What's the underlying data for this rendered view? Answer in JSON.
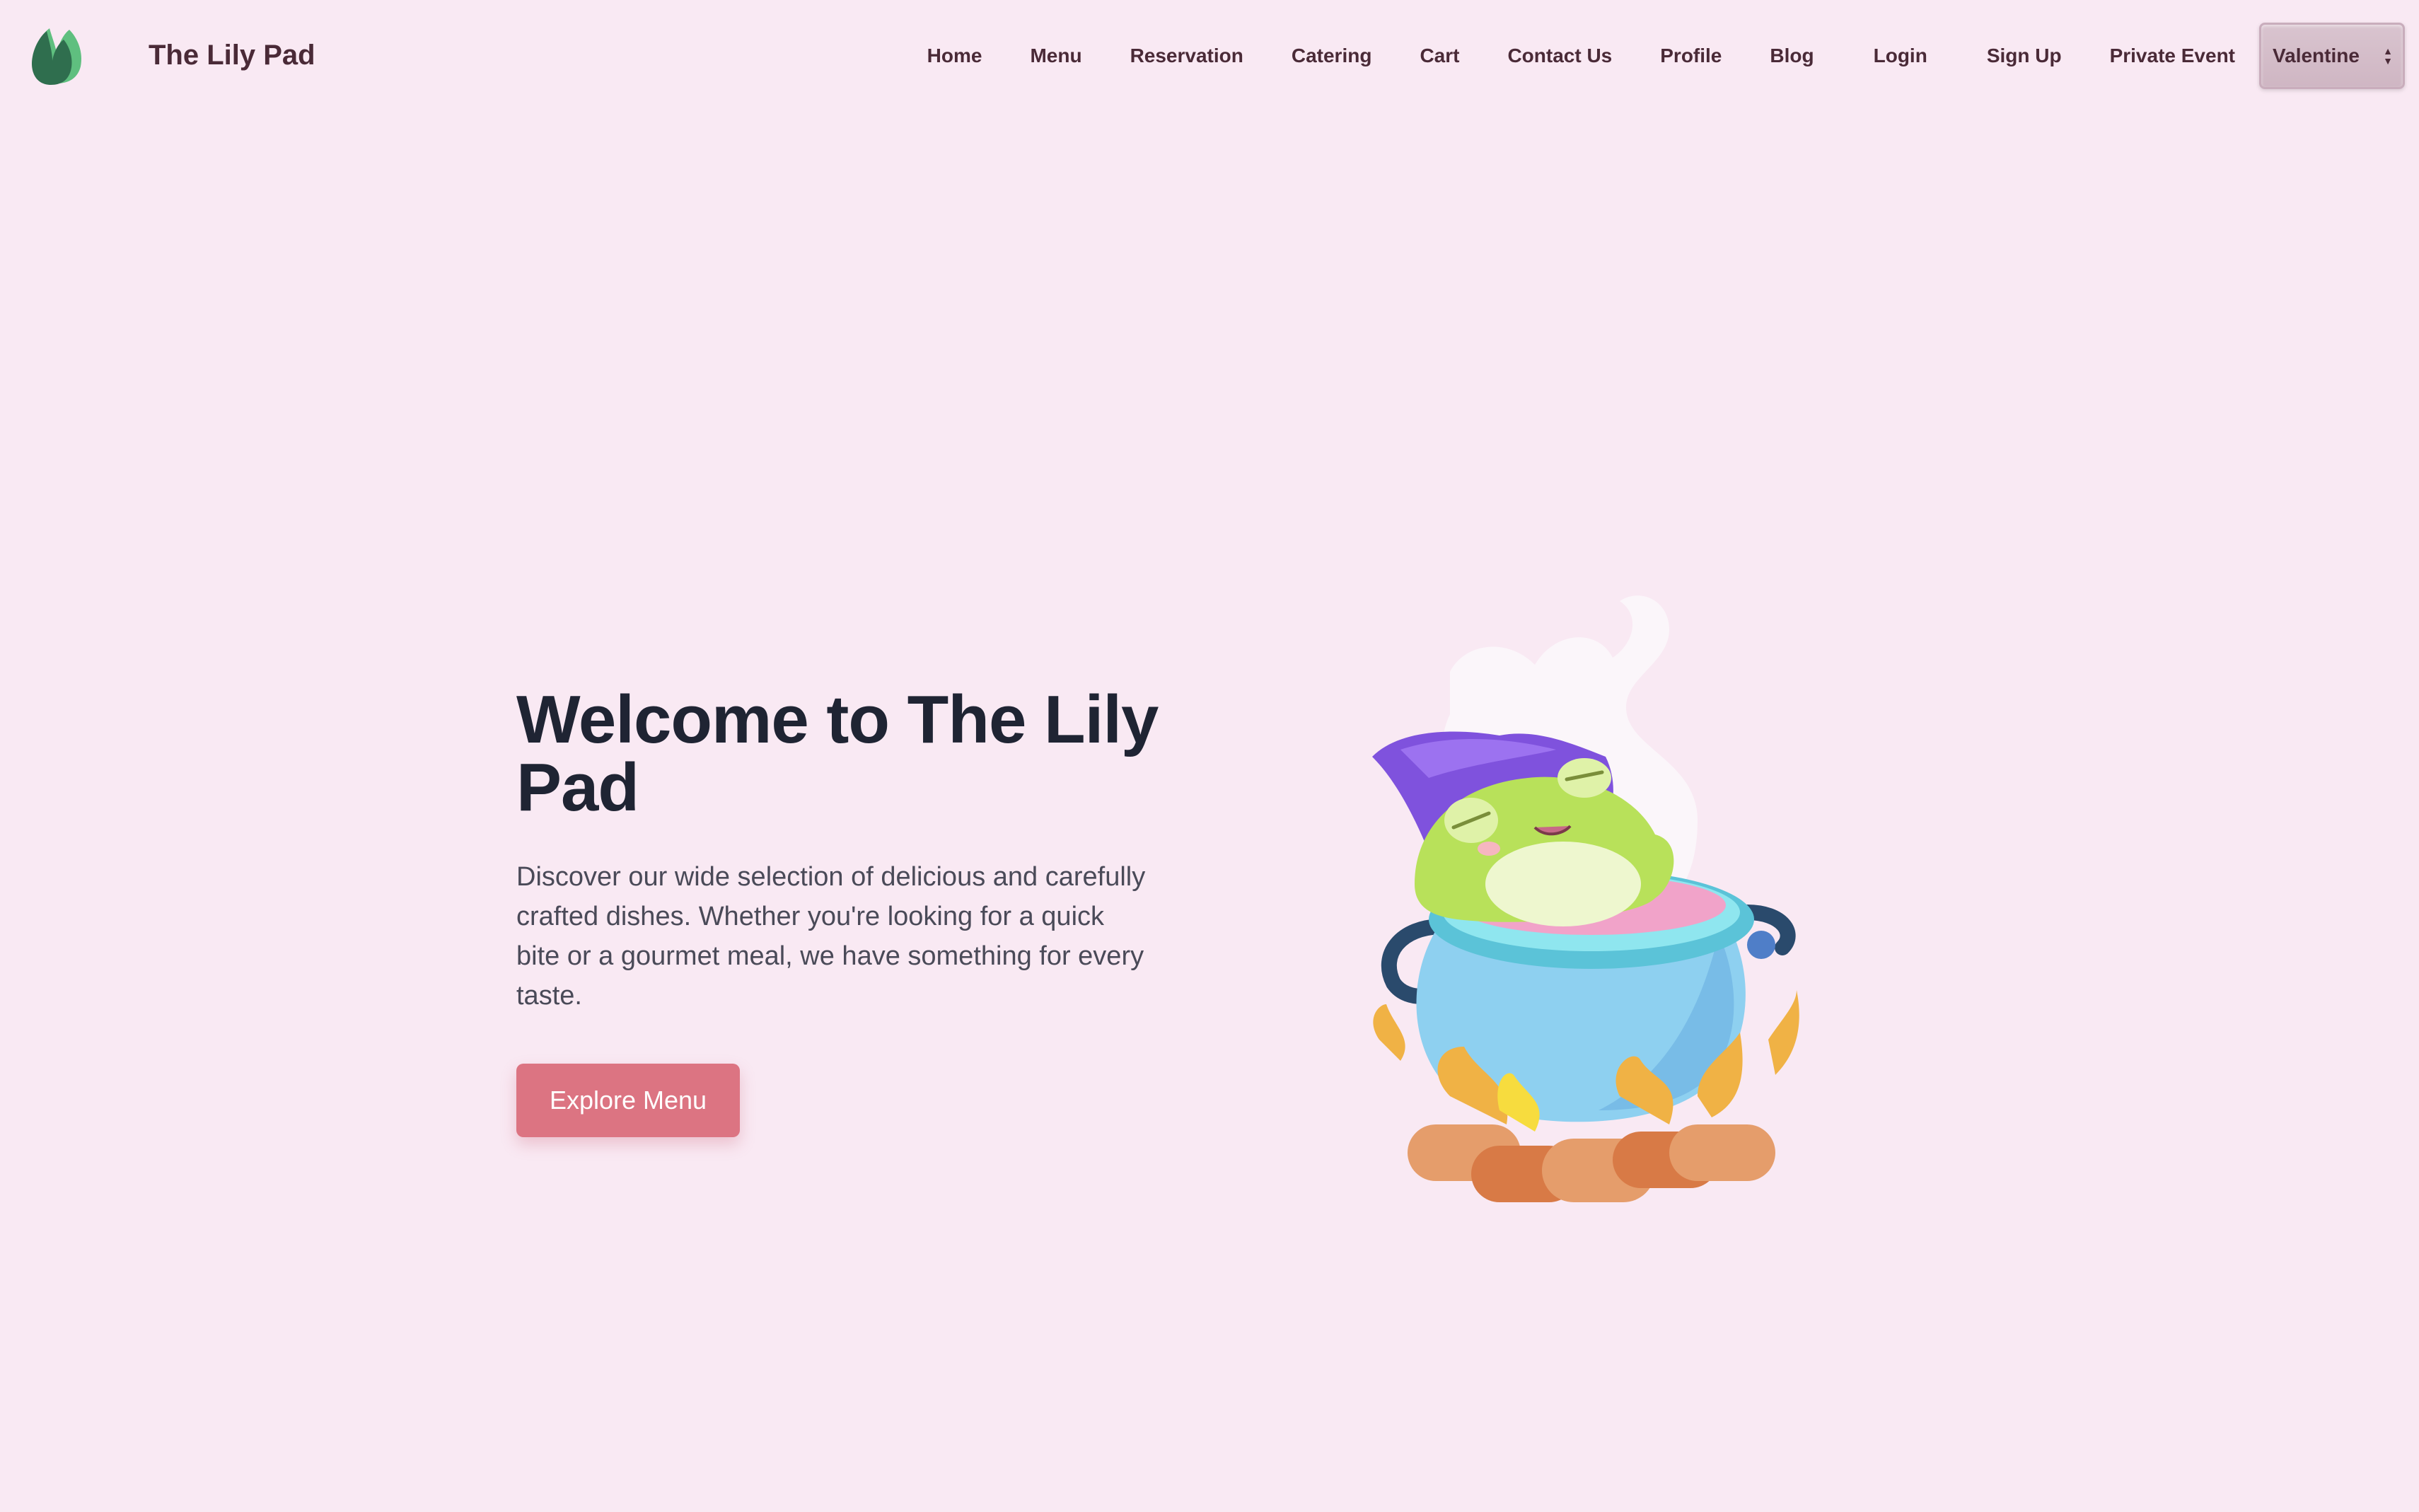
{
  "brand": {
    "name": "The Lily Pad",
    "logo_icon": "lily-leaf-icon"
  },
  "nav": {
    "links": [
      "Home",
      "Menu",
      "Reservation",
      "Catering",
      "Cart",
      "Contact Us",
      "Profile",
      "Blog",
      "Login",
      "Sign Up",
      "Private Event"
    ],
    "theme_select": {
      "selected": "Valentine",
      "icon": "updown-arrows-icon"
    }
  },
  "hero": {
    "title": "Welcome to The Lily Pad",
    "description": "Discover our wide selection of delicious and carefully crafted dishes. Whether you're looking for a quick bite or a gourmet meal, we have something for every taste.",
    "cta_label": "Explore Menu",
    "illustration": "frog-in-cauldron-illustration"
  },
  "colors": {
    "background": "#f9e9f3",
    "brand_text": "#4a2a37",
    "title": "#1f2433",
    "cta": "#dc7482"
  }
}
